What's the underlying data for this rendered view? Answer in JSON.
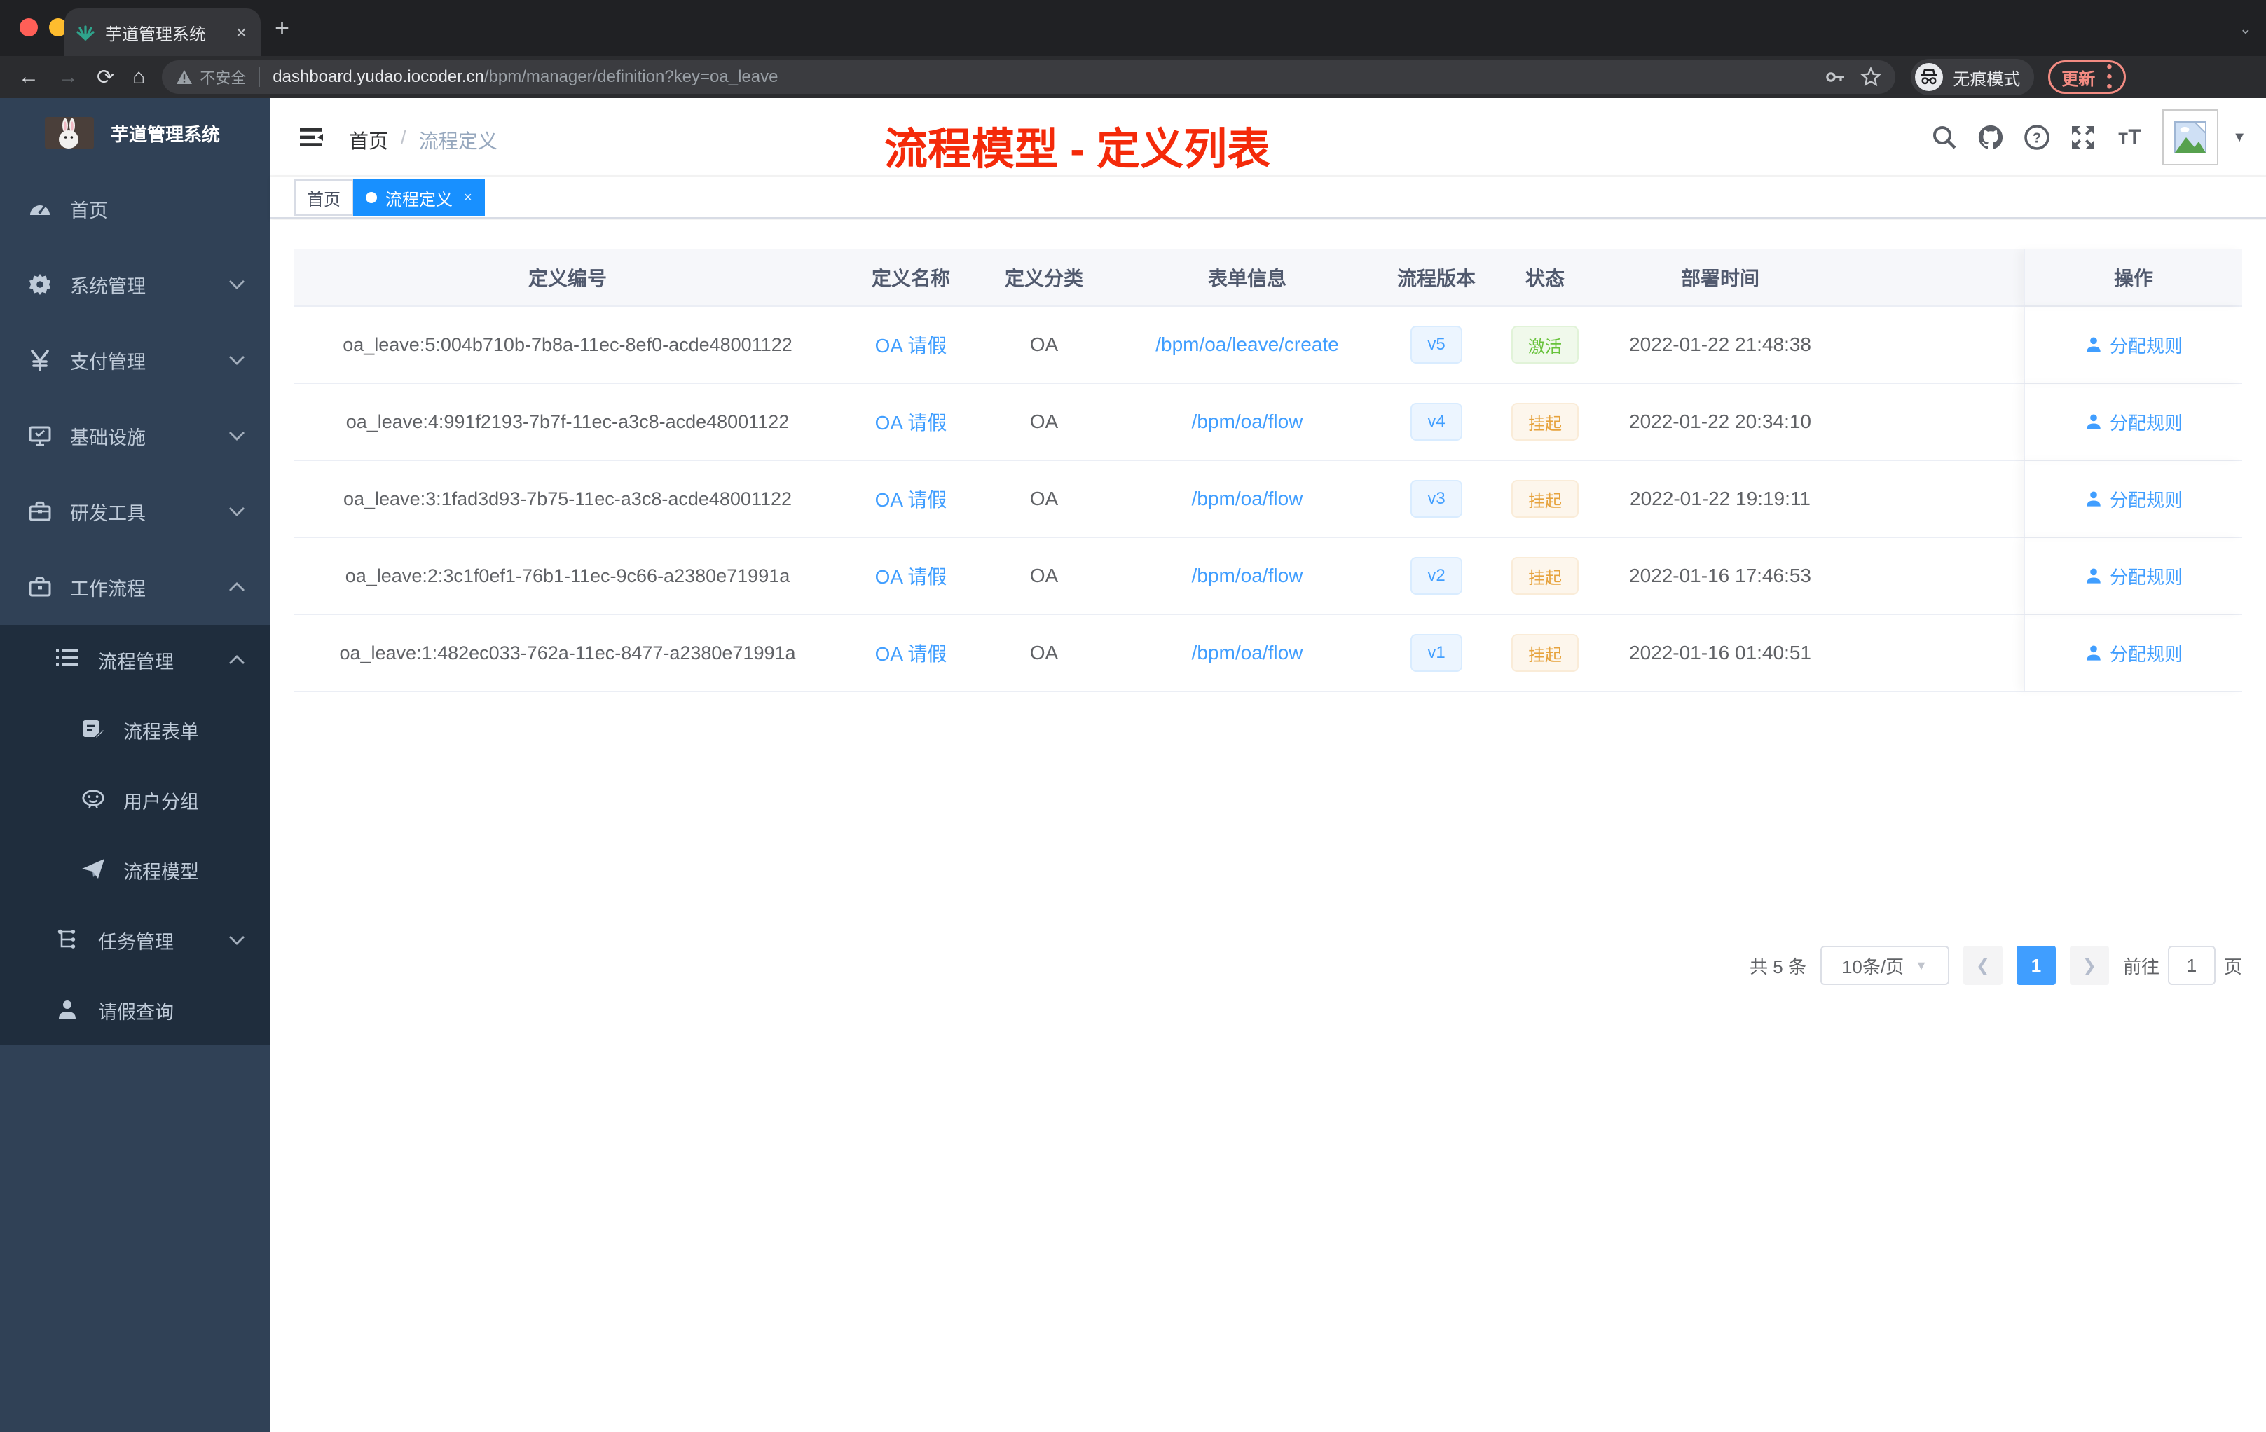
{
  "browser": {
    "tab": {
      "title": "芋道管理系统",
      "close": "×"
    },
    "new_tab": "+",
    "url": {
      "security_label": "不安全",
      "domain": "dashboard.yudao.iocoder.cn",
      "path": "/bpm/manager/definition?key=oa_leave"
    },
    "incognito_label": "无痕模式",
    "update_label": "更新",
    "colors": {
      "light_red": "#ff5f57",
      "light_yellow": "#febc2e",
      "light_green": "#28c840",
      "update_red": "#f28b82"
    }
  },
  "sidebar": {
    "logo_title": "芋道管理系统",
    "items": [
      {
        "label": "首页"
      },
      {
        "label": "系统管理"
      },
      {
        "label": "支付管理"
      },
      {
        "label": "基础设施"
      },
      {
        "label": "研发工具"
      },
      {
        "label": "工作流程"
      }
    ],
    "submenu": [
      {
        "label": "流程管理"
      },
      {
        "label": "流程表单"
      },
      {
        "label": "用户分组"
      },
      {
        "label": "流程模型"
      },
      {
        "label": "任务管理"
      },
      {
        "label": "请假查询"
      }
    ],
    "colors": {
      "bg": "#304156",
      "submenu_bg": "#1f2d3d",
      "text": "#bfcbd9"
    }
  },
  "header": {
    "breadcrumb_home": "首页",
    "breadcrumb_sep": "/",
    "breadcrumb_current": "流程定义",
    "annotation": "流程模型 - 定义列表",
    "annotation_color": "#f42a0a"
  },
  "tags": {
    "home": "首页",
    "active": "流程定义",
    "active_close": "×",
    "active_bg": "#1890ff"
  },
  "table": {
    "columns": [
      "定义编号",
      "定义名称",
      "定义分类",
      "表单信息",
      "流程版本",
      "状态",
      "部署时间",
      "操作"
    ],
    "rows": [
      {
        "id": "oa_leave:5:004b710b-7b8a-11ec-8ef0-acde48001122",
        "name": "OA 请假",
        "category": "OA",
        "form": "/bpm/oa/leave/create",
        "version": "v5",
        "status": "激活",
        "status_type": "success",
        "deploy_time": "2022-01-22 21:48:38",
        "action": "分配规则"
      },
      {
        "id": "oa_leave:4:991f2193-7b7f-11ec-a3c8-acde48001122",
        "name": "OA 请假",
        "category": "OA",
        "form": "/bpm/oa/flow",
        "version": "v4",
        "status": "挂起",
        "status_type": "warning",
        "deploy_time": "2022-01-22 20:34:10",
        "action": "分配规则"
      },
      {
        "id": "oa_leave:3:1fad3d93-7b75-11ec-a3c8-acde48001122",
        "name": "OA 请假",
        "category": "OA",
        "form": "/bpm/oa/flow",
        "version": "v3",
        "status": "挂起",
        "status_type": "warning",
        "deploy_time": "2022-01-22 19:19:11",
        "action": "分配规则"
      },
      {
        "id": "oa_leave:2:3c1f0ef1-76b1-11ec-9c66-a2380e71991a",
        "name": "OA 请假",
        "category": "OA",
        "form": "/bpm/oa/flow",
        "version": "v2",
        "status": "挂起",
        "status_type": "warning",
        "deploy_time": "2022-01-16 17:46:53",
        "action": "分配规则"
      },
      {
        "id": "oa_leave:1:482ec033-762a-11ec-8477-a2380e71991a",
        "name": "OA 请假",
        "category": "OA",
        "form": "/bpm/oa/flow",
        "version": "v1",
        "status": "挂起",
        "status_type": "warning",
        "deploy_time": "2022-01-16 01:40:51",
        "action": "分配规则"
      }
    ],
    "status_colors": {
      "success": "#67c23a",
      "warning": "#e6a23c",
      "version_blue": "#409eff"
    }
  },
  "pagination": {
    "total": "共 5 条",
    "page_size": "10条/页",
    "current_page": "1",
    "goto_label": "前往",
    "goto_value": "1",
    "goto_unit": "页"
  }
}
